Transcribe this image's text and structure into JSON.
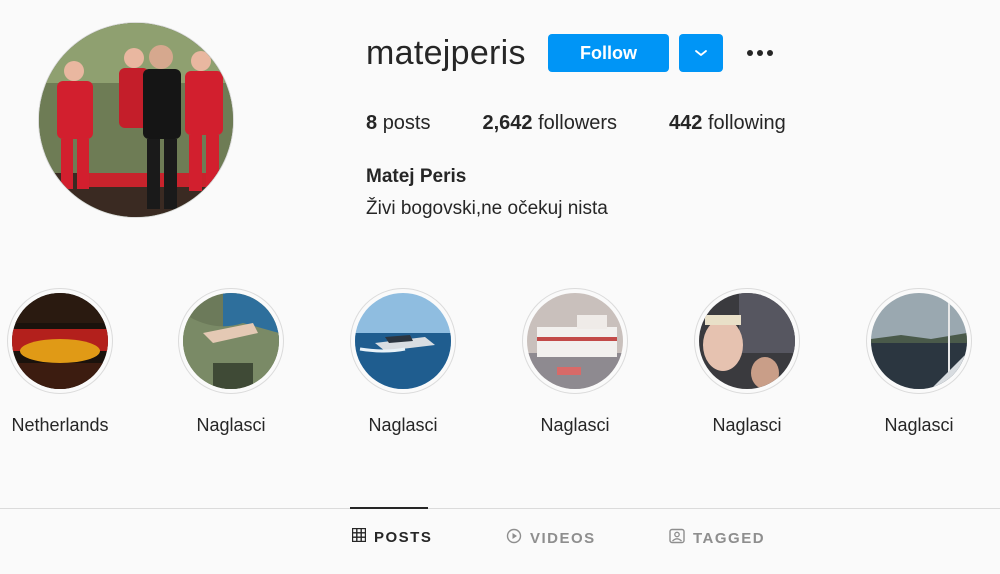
{
  "profile": {
    "username": "matejperis",
    "follow_label": "Follow",
    "dropdown_icon": "chevron-down-icon",
    "more_icon": "more-horizontal-icon",
    "posts_count": "8",
    "posts_label": "posts",
    "followers_count": "2,642",
    "followers_label": "followers",
    "following_count": "442",
    "following_label": "following",
    "full_name": "Matej Peris",
    "bio": "Živi bogovski,ne očekuj nista"
  },
  "highlights": [
    {
      "label": "Netherlands"
    },
    {
      "label": "Naglasci"
    },
    {
      "label": "Naglasci"
    },
    {
      "label": "Naglasci"
    },
    {
      "label": "Naglasci"
    },
    {
      "label": "Naglasci"
    }
  ],
  "tabs": {
    "posts": "POSTS",
    "videos": "VIDEOS",
    "tagged": "TAGGED",
    "active": "posts"
  },
  "colors": {
    "accent": "#0095f6",
    "background": "#fafafa",
    "text": "#262626",
    "muted": "#8e8e8e",
    "border": "#dbdbdb"
  }
}
